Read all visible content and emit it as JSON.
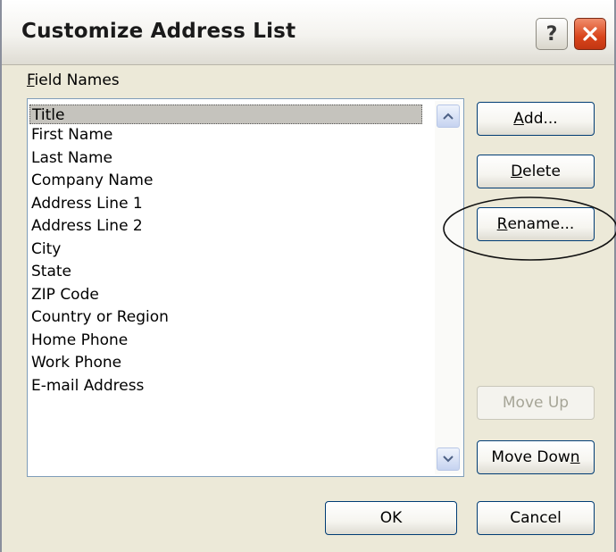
{
  "window": {
    "title": "Customize Address List"
  },
  "titlebar_buttons": {
    "help_glyph": "?",
    "close_icon": "close-icon"
  },
  "field_names": {
    "label_mnemonic": "F",
    "label_rest": "ield Names",
    "items": [
      "Title",
      "First Name",
      "Last Name",
      "Company Name",
      "Address Line 1",
      "Address Line 2",
      "City",
      "State",
      "ZIP Code",
      "Country or Region",
      "Home Phone",
      "Work Phone",
      "E-mail Address"
    ],
    "selected": "Title"
  },
  "buttons": {
    "add": {
      "mnemonic": "A",
      "rest": "dd..."
    },
    "delete": {
      "mnemonic": "D",
      "rest": "elete"
    },
    "rename": {
      "mnemonic": "R",
      "rest": "ename..."
    },
    "move_up": {
      "label": "Move Up",
      "enabled": false
    },
    "move_down": {
      "before": "Move Dow",
      "mnemonic": "n"
    },
    "ok": "OK",
    "cancel": "Cancel"
  },
  "colors": {
    "dialog_bg": "#ece9d8",
    "close_button": "#d9441b",
    "selection_bg": "#c5c3bd",
    "button_border": "#003c74"
  }
}
